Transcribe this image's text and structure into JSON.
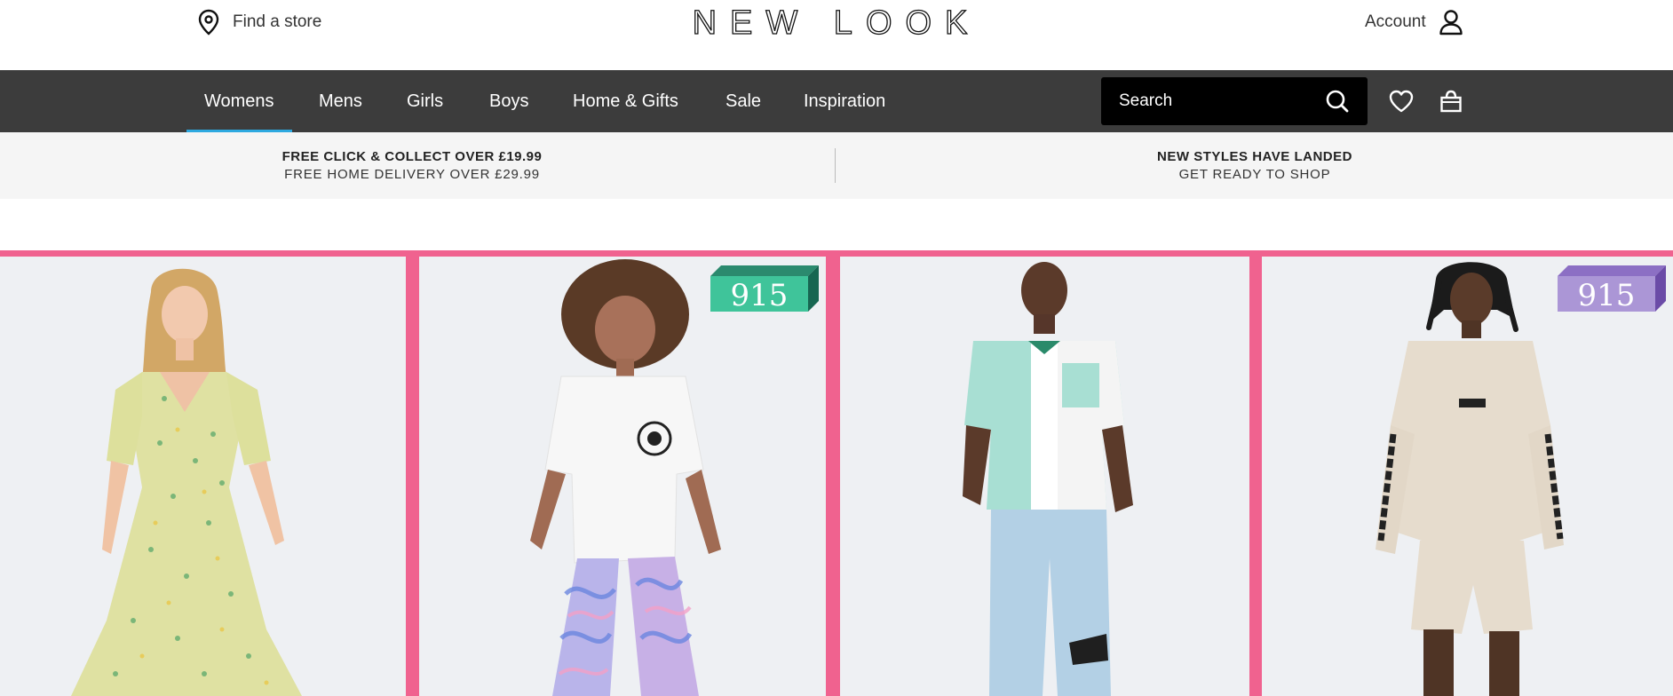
{
  "header": {
    "find_store_label": "Find a store",
    "brand_name": "NEW LOOK",
    "account_label": "Account"
  },
  "nav": {
    "items": [
      {
        "label": "Womens",
        "active": true
      },
      {
        "label": "Mens"
      },
      {
        "label": "Girls"
      },
      {
        "label": "Boys"
      },
      {
        "label": "Home & Gifts"
      },
      {
        "label": "Sale"
      },
      {
        "label": "Inspiration"
      }
    ],
    "search_placeholder": "Search",
    "icons": [
      "search-icon",
      "heart-icon",
      "bag-icon"
    ]
  },
  "promo": {
    "left": {
      "title": "FREE CLICK & COLLECT OVER £19.99",
      "subtitle": "FREE HOME DELIVERY OVER £29.99"
    },
    "right": {
      "title": "NEW STYLES HAVE LANDED",
      "subtitle": "GET READY TO SHOP"
    }
  },
  "hero": {
    "tiles": [
      {
        "subject": "woman in yellow floral midi dress"
      },
      {
        "subject": "girl in white t-shirt and swirl print flares",
        "badge": "915"
      },
      {
        "subject": "man in colour block shirt and light jeans"
      },
      {
        "subject": "boy in stone hoodie and shorts",
        "badge": "915"
      }
    ]
  },
  "colors": {
    "nav_bg": "#3c3c3c",
    "active_underline": "#2ea9e0",
    "hero_border": "#f0628f",
    "badge_green": "#3fc49a",
    "badge_purple": "#ab96d6"
  }
}
